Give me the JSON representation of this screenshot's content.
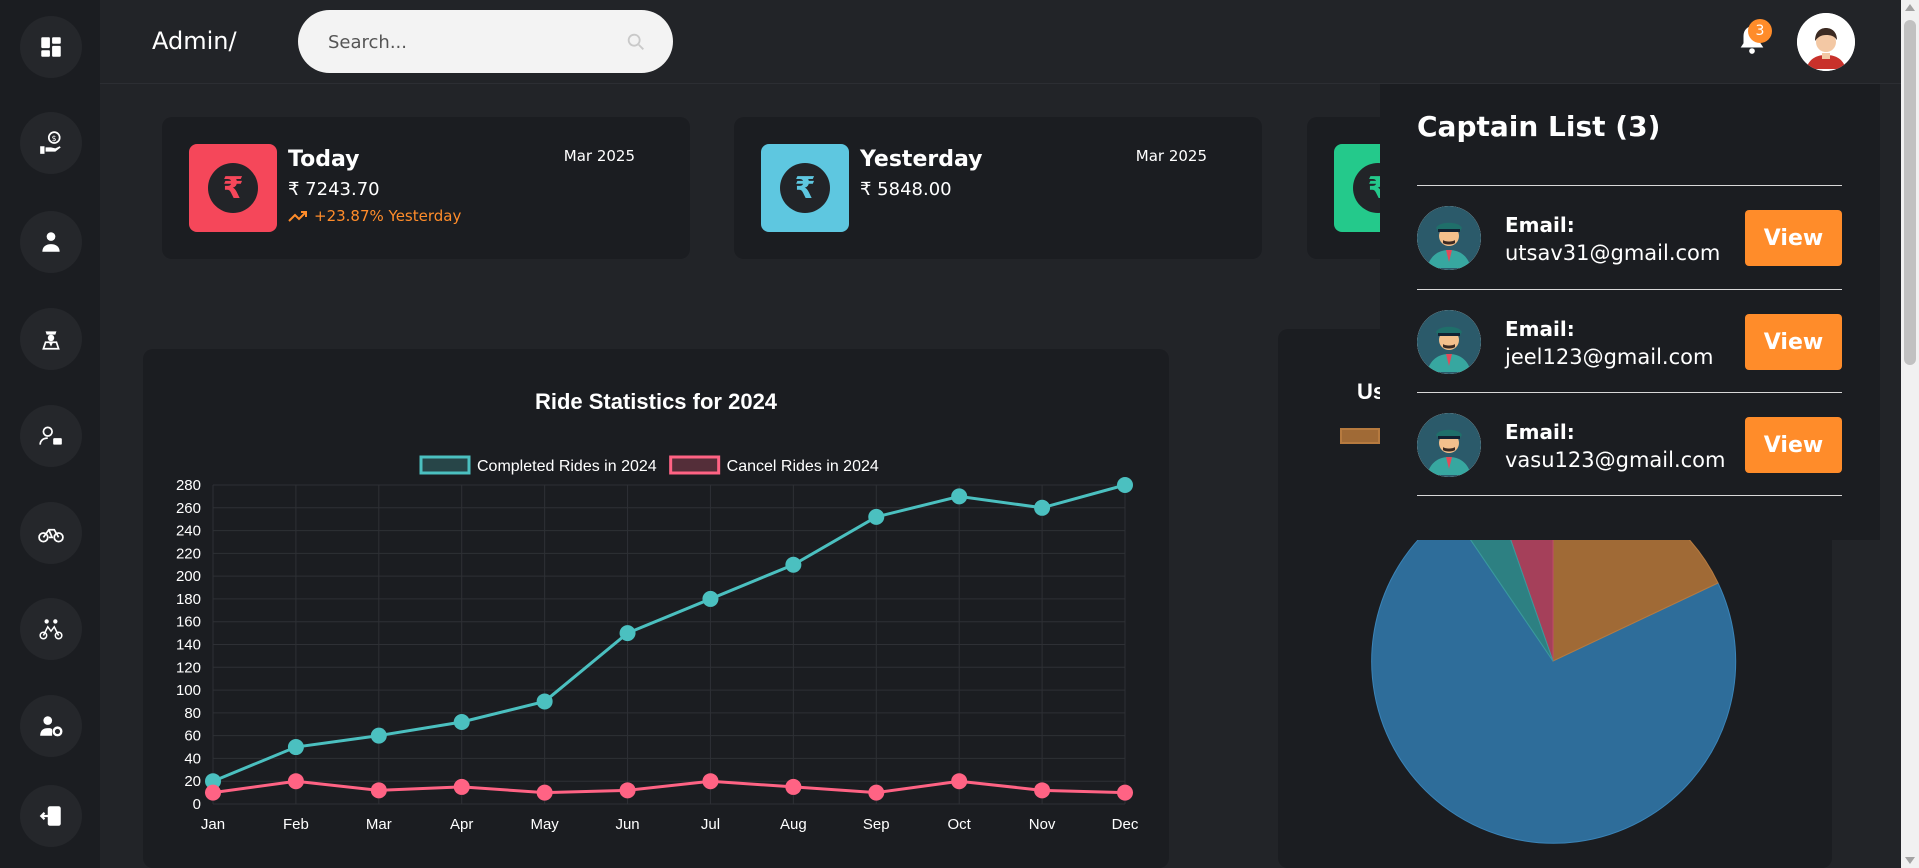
{
  "header": {
    "brand": "Admin/",
    "search_placeholder": "Search...",
    "notification_count": "3"
  },
  "sidebar": {
    "icons": [
      "dashboard-icon",
      "payment-icon",
      "user-icon",
      "captain-icon",
      "user-manage-icon",
      "bike-icon",
      "riders-icon",
      "user-settings-icon",
      "logout-icon"
    ]
  },
  "cards": [
    {
      "title": "Today",
      "amount": "₹ 7243.70",
      "change": "+23.87% Yesterday",
      "date": "Mar 2025",
      "color": "#f5475a"
    },
    {
      "title": "Yesterday",
      "amount": "₹ 5848.00",
      "change": "",
      "date": "Mar 2025",
      "color": "#5ec7e0"
    },
    {
      "title": "",
      "amount": "",
      "change": "",
      "date": "",
      "color": "#24c98b"
    }
  ],
  "captain_list": {
    "title": "Captain List (3)",
    "email_label": "Email:",
    "view_label": "View",
    "items": [
      {
        "email": "utsav31@gmail.com"
      },
      {
        "email": "jeel123@gmail.com"
      },
      {
        "email": "vasu123@gmail.com"
      }
    ]
  },
  "pie": {
    "title_fragment": "Us"
  },
  "chart_data": {
    "type": "line",
    "title": "Ride Statistics for 2024",
    "categories": [
      "Jan",
      "Feb",
      "Mar",
      "Apr",
      "May",
      "Jun",
      "Jul",
      "Aug",
      "Sep",
      "Oct",
      "Nov",
      "Dec"
    ],
    "series": [
      {
        "name": "Completed Rides in 2024",
        "color": "#4bc0c0",
        "values": [
          20,
          50,
          60,
          72,
          90,
          150,
          180,
          210,
          252,
          270,
          260,
          280
        ]
      },
      {
        "name": "Cancel Rides in 2024",
        "color": "#ff6384",
        "values": [
          10,
          20,
          12,
          15,
          10,
          12,
          20,
          15,
          10,
          20,
          12,
          10
        ]
      }
    ],
    "yticks": [
      0,
      20,
      40,
      60,
      80,
      100,
      120,
      140,
      160,
      180,
      200,
      220,
      240,
      260,
      280
    ],
    "ylim": [
      0,
      280
    ],
    "grid": true,
    "legend": "top"
  }
}
